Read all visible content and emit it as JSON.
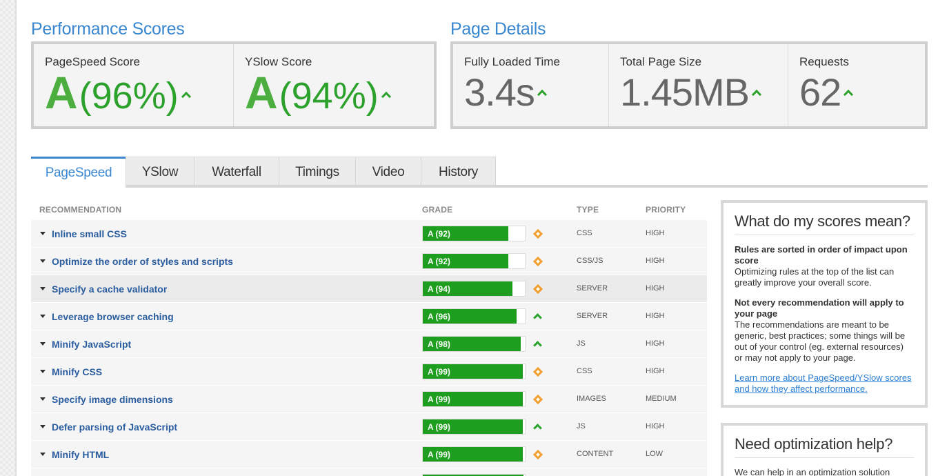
{
  "performance": {
    "title": "Performance Scores",
    "pagespeed": {
      "label": "PageSpeed Score",
      "grade": "A",
      "percent": "(96%)"
    },
    "yslow": {
      "label": "YSlow Score",
      "grade": "A",
      "percent": "(94%)"
    }
  },
  "details": {
    "title": "Page Details",
    "loaded": {
      "label": "Fully Loaded Time",
      "value": "3.4s"
    },
    "size": {
      "label": "Total Page Size",
      "value": "1.45MB"
    },
    "requests": {
      "label": "Requests",
      "value": "62"
    }
  },
  "tabs": [
    "PageSpeed",
    "YSlow",
    "Waterfall",
    "Timings",
    "Video",
    "History"
  ],
  "columns": {
    "recommendation": "RECOMMENDATION",
    "grade": "GRADE",
    "type": "TYPE",
    "priority": "PRIORITY"
  },
  "rows": [
    {
      "name": "Inline small CSS",
      "grade": "A (92)",
      "score": 92,
      "indicator": "diamond",
      "type": "CSS",
      "priority": "HIGH"
    },
    {
      "name": "Optimize the order of styles and scripts",
      "grade": "A (92)",
      "score": 92,
      "indicator": "diamond",
      "type": "CSS/JS",
      "priority": "HIGH"
    },
    {
      "name": "Specify a cache validator",
      "grade": "A (94)",
      "score": 94,
      "indicator": "diamond",
      "type": "SERVER",
      "priority": "HIGH"
    },
    {
      "name": "Leverage browser caching",
      "grade": "A (96)",
      "score": 96,
      "indicator": "up",
      "type": "SERVER",
      "priority": "HIGH"
    },
    {
      "name": "Minify JavaScript",
      "grade": "A (98)",
      "score": 98,
      "indicator": "up",
      "type": "JS",
      "priority": "HIGH"
    },
    {
      "name": "Minify CSS",
      "grade": "A (99)",
      "score": 99,
      "indicator": "diamond",
      "type": "CSS",
      "priority": "HIGH"
    },
    {
      "name": "Specify image dimensions",
      "grade": "A (99)",
      "score": 99,
      "indicator": "diamond",
      "type": "IMAGES",
      "priority": "MEDIUM"
    },
    {
      "name": "Defer parsing of JavaScript",
      "grade": "A (99)",
      "score": 99,
      "indicator": "up",
      "type": "JS",
      "priority": "HIGH"
    },
    {
      "name": "Minify HTML",
      "grade": "A (99)",
      "score": 99,
      "indicator": "diamond",
      "type": "CONTENT",
      "priority": "LOW"
    }
  ],
  "sidebar": {
    "scores_box": {
      "title": "What do my scores mean?",
      "p1_bold": "Rules are sorted in order of impact upon score",
      "p1_text": "Optimizing rules at the top of the list can greatly improve your overall score.",
      "p2_bold": "Not every recommendation will apply to your page",
      "p2_text": "The recommendations are meant to be generic, best practices; some things will be out of your control (eg. external resources) or may not apply to your page.",
      "link": "Learn more about PageSpeed/YSlow scores and how they affect performance."
    },
    "help_box": {
      "title": "Need optimization help?",
      "text": "We can help in an optimization solution"
    }
  },
  "colors": {
    "accent": "#3a87cf",
    "grade_green": "#1e9e1e",
    "warning": "#f0a030"
  }
}
